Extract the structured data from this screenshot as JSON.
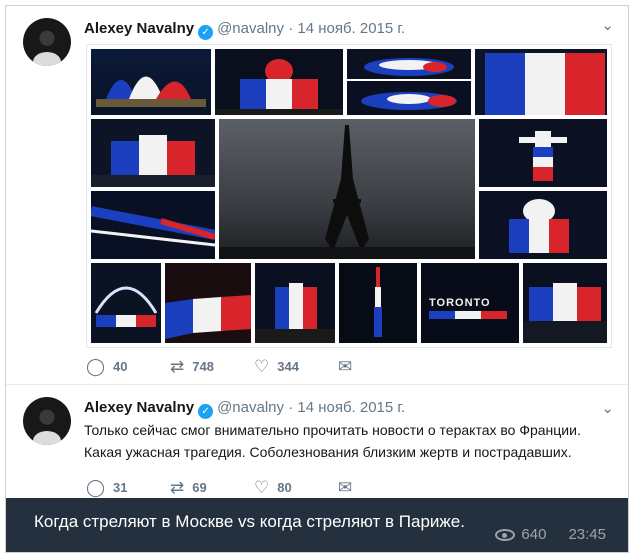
{
  "tweets": [
    {
      "name": "Alexey Navalny",
      "handle": "@navalny",
      "date": "· 14 нояб. 2015 г.",
      "replies": "40",
      "retweets": "748",
      "likes": "344"
    },
    {
      "name": "Alexey Navalny",
      "handle": "@navalny",
      "date": "· 14 нояб. 2015 г.",
      "text_line1": "Только сейчас смог внимательно прочитать новости о терактах во Франции.",
      "text_line2": "Какая ужасная трагедия. Соболезнования близким жертв и пострадавших.",
      "replies": "31",
      "retweets": "69",
      "likes": "80"
    }
  ],
  "icons": {
    "verified": "verified-check-icon",
    "chevron": "chevron-down-icon",
    "reply": "reply-icon",
    "retweet": "retweet-icon",
    "like": "heart-icon",
    "dm": "envelope-icon",
    "views": "eye-icon"
  },
  "colors": {
    "french_blue": "#1b3fbf",
    "french_white": "#f2f2f2",
    "french_red": "#d8252c",
    "caption_bg": "#25303e"
  },
  "caption": {
    "message": "Когда стреляют в Москве vs когда стреляют в Париже.",
    "views": "640",
    "time": "23:45"
  },
  "collage": {
    "toronto_sign": "TORONTO"
  }
}
